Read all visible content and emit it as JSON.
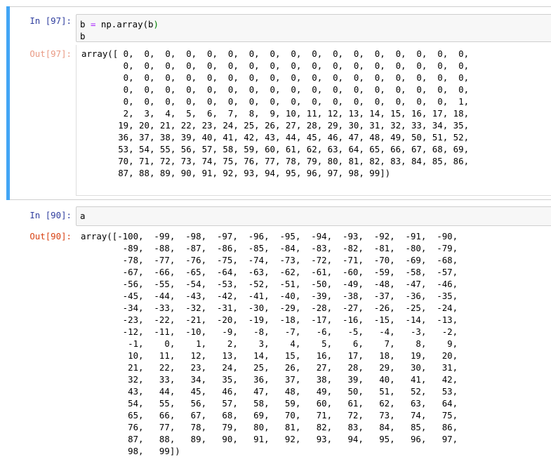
{
  "cells": [
    {
      "in_prompt": "In [97]:",
      "code": {
        "var": "b",
        "op": "=",
        "call": "np.array",
        "arg": "b",
        "line2": "b"
      },
      "out_prompt": "Out[97]:",
      "output": "array([ 0,  0,  0,  0,  0,  0,  0,  0,  0,  0,  0,  0,  0,  0,  0,  0,  0,\n        0,  0,  0,  0,  0,  0,  0,  0,  0,  0,  0,  0,  0,  0,  0,  0,  0,\n        0,  0,  0,  0,  0,  0,  0,  0,  0,  0,  0,  0,  0,  0,  0,  0,  0,\n        0,  0,  0,  0,  0,  0,  0,  0,  0,  0,  0,  0,  0,  0,  0,  0,  0,\n        0,  0,  0,  0,  0,  0,  0,  0,  0,  0,  0,  0,  0,  0,  0,  0,  1,\n        2,  3,  4,  5,  6,  7,  8,  9, 10, 11, 12, 13, 14, 15, 16, 17, 18,\n       19, 20, 21, 22, 23, 24, 25, 26, 27, 28, 29, 30, 31, 32, 33, 34, 35,\n       36, 37, 38, 39, 40, 41, 42, 43, 44, 45, 46, 47, 48, 49, 50, 51, 52,\n       53, 54, 55, 56, 57, 58, 59, 60, 61, 62, 63, 64, 65, 66, 67, 68, 69,\n       70, 71, 72, 73, 74, 75, 76, 77, 78, 79, 80, 81, 82, 83, 84, 85, 86,\n       87, 88, 89, 90, 91, 92, 93, 94, 95, 96, 97, 98, 99])"
    },
    {
      "in_prompt": "In [90]:",
      "code_text": "a",
      "out_prompt": "Out[90]:",
      "output": "array([-100,  -99,  -98,  -97,  -96,  -95,  -94,  -93,  -92,  -91,  -90,\n        -89,  -88,  -87,  -86,  -85,  -84,  -83,  -82,  -81,  -80,  -79,\n        -78,  -77,  -76,  -75,  -74,  -73,  -72,  -71,  -70,  -69,  -68,\n        -67,  -66,  -65,  -64,  -63,  -62,  -61,  -60,  -59,  -58,  -57,\n        -56,  -55,  -54,  -53,  -52,  -51,  -50,  -49,  -48,  -47,  -46,\n        -45,  -44,  -43,  -42,  -41,  -40,  -39,  -38,  -37,  -36,  -35,\n        -34,  -33,  -32,  -31,  -30,  -29,  -28,  -27,  -26,  -25,  -24,\n        -23,  -22,  -21,  -20,  -19,  -18,  -17,  -16,  -15,  -14,  -13,\n        -12,  -11,  -10,   -9,   -8,   -7,   -6,   -5,   -4,   -3,   -2,\n         -1,    0,    1,    2,    3,    4,    5,    6,    7,    8,    9,\n         10,   11,   12,   13,   14,   15,   16,   17,   18,   19,   20,\n         21,   22,   23,   24,   25,   26,   27,   28,   29,   30,   31,\n         32,   33,   34,   35,   36,   37,   38,   39,   40,   41,   42,\n         43,   44,   45,   46,   47,   48,   49,   50,   51,   52,   53,\n         54,   55,   56,   57,   58,   59,   60,   61,   62,   63,   64,\n         65,   66,   67,   68,   69,   70,   71,   72,   73,   74,   75,\n         76,   77,   78,   79,   80,   81,   82,   83,   84,   85,   86,\n         87,   88,   89,   90,   91,   92,   93,   94,   95,   96,   97,\n         98,   99])"
    }
  ],
  "colors": {
    "selected_bar": "#42a5f5",
    "in_prompt": "#303f9f",
    "out_prompt": "#d84315",
    "out_prompt_faded": "#e99a84",
    "operator": "#aa22ff",
    "input_bg": "#f7f7f7",
    "border": "#cfcfcf"
  }
}
